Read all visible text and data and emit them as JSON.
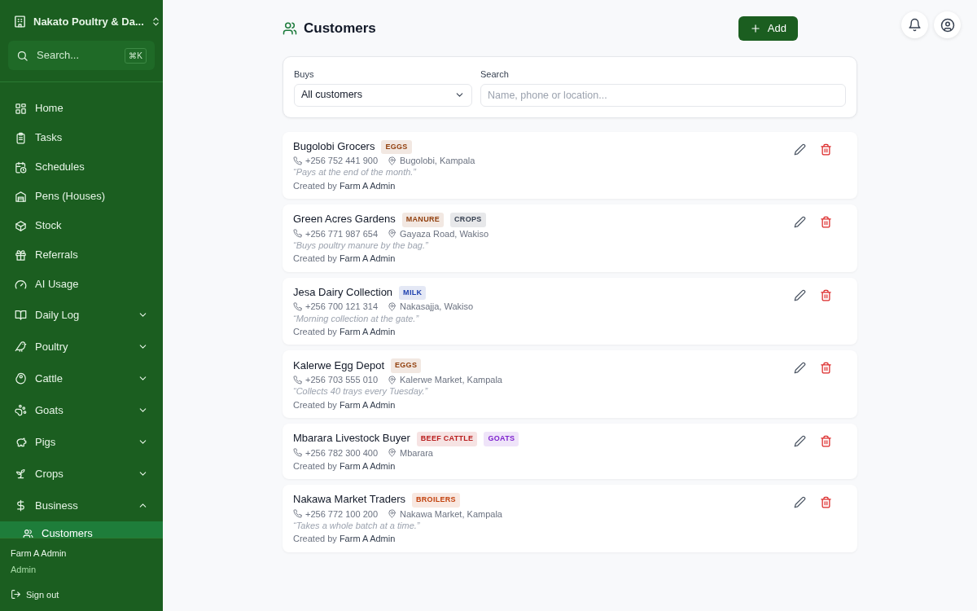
{
  "sidebar": {
    "brand": "Nakato Poultry & Da...",
    "search": {
      "placeholder": "Search...",
      "shortcut": "⌘K"
    },
    "items": [
      {
        "label": "Home",
        "kind": "link",
        "selected": false
      },
      {
        "label": "Tasks",
        "kind": "link",
        "selected": false
      },
      {
        "label": "Schedules",
        "kind": "link",
        "selected": false
      },
      {
        "label": "Pens (Houses)",
        "kind": "link",
        "selected": false
      },
      {
        "label": "Stock",
        "kind": "link",
        "selected": false
      },
      {
        "label": "Referrals",
        "kind": "link",
        "selected": false
      },
      {
        "label": "AI Usage",
        "kind": "link",
        "selected": false
      },
      {
        "label": "Daily Log",
        "kind": "group",
        "expanded": false
      },
      {
        "label": "Poultry",
        "kind": "group",
        "expanded": false
      },
      {
        "label": "Cattle",
        "kind": "group",
        "expanded": false
      },
      {
        "label": "Goats",
        "kind": "group",
        "expanded": false
      },
      {
        "label": "Pigs",
        "kind": "group",
        "expanded": false
      },
      {
        "label": "Crops",
        "kind": "group",
        "expanded": false
      },
      {
        "label": "Business",
        "kind": "group",
        "expanded": true,
        "children": [
          {
            "label": "Customers",
            "selected": true
          }
        ]
      }
    ],
    "user": {
      "name": "Farm A Admin",
      "role": "Admin",
      "sign_out": "Sign out"
    }
  },
  "page": {
    "title": "Customers",
    "add_button": "Add"
  },
  "filters": {
    "buys_label": "Buys",
    "buys_value": "All customers",
    "search_label": "Search",
    "search_placeholder": "Name, phone or location..."
  },
  "customers": [
    {
      "name": "Bugolobi Grocers",
      "tags": [
        {
          "label": "EGGS",
          "color": "#92400e"
        }
      ],
      "phone": "+256 752 441 900",
      "location": "Bugolobi, Kampala",
      "note": "“Pays at the end of the month.”",
      "created_prefix": "Created by",
      "created_by": "Farm A Admin"
    },
    {
      "name": "Green Acres Gardens",
      "tags": [
        {
          "label": "MANURE",
          "color": "#92400e"
        },
        {
          "label": "CROPS",
          "color": "#374151"
        }
      ],
      "phone": "+256 771 987 654",
      "location": "Gayaza Road, Wakiso",
      "note": "“Buys poultry manure by the bag.”",
      "created_prefix": "Created by",
      "created_by": "Farm A Admin"
    },
    {
      "name": "Jesa Dairy Collection",
      "tags": [
        {
          "label": "MILK",
          "color": "#1e40af"
        }
      ],
      "phone": "+256 700 121 314",
      "location": "Nakasajja, Wakiso",
      "note": "“Morning collection at the gate.”",
      "created_prefix": "Created by",
      "created_by": "Farm A Admin"
    },
    {
      "name": "Kalerwe Egg Depot",
      "tags": [
        {
          "label": "EGGS",
          "color": "#92400e"
        }
      ],
      "phone": "+256 703 555 010",
      "location": "Kalerwe Market, Kampala",
      "note": "“Collects 40 trays every Tuesday.”",
      "created_prefix": "Created by",
      "created_by": "Farm A Admin"
    },
    {
      "name": "Mbarara Livestock Buyer",
      "tags": [
        {
          "label": "BEEF CATTLE",
          "color": "#b91c1c"
        },
        {
          "label": "GOATS",
          "color": "#7e22ce"
        }
      ],
      "phone": "+256 782 300 400",
      "location": "Mbarara",
      "created_prefix": "Created by",
      "created_by": "Farm A Admin"
    },
    {
      "name": "Nakawa Market Traders",
      "tags": [
        {
          "label": "BROILERS",
          "color": "#c2410c"
        }
      ],
      "phone": "+256 772 100 200",
      "location": "Nakawa Market, Kampala",
      "note": "“Takes a whole batch at a time.”",
      "created_prefix": "Created by",
      "created_by": "Farm A Admin"
    }
  ]
}
